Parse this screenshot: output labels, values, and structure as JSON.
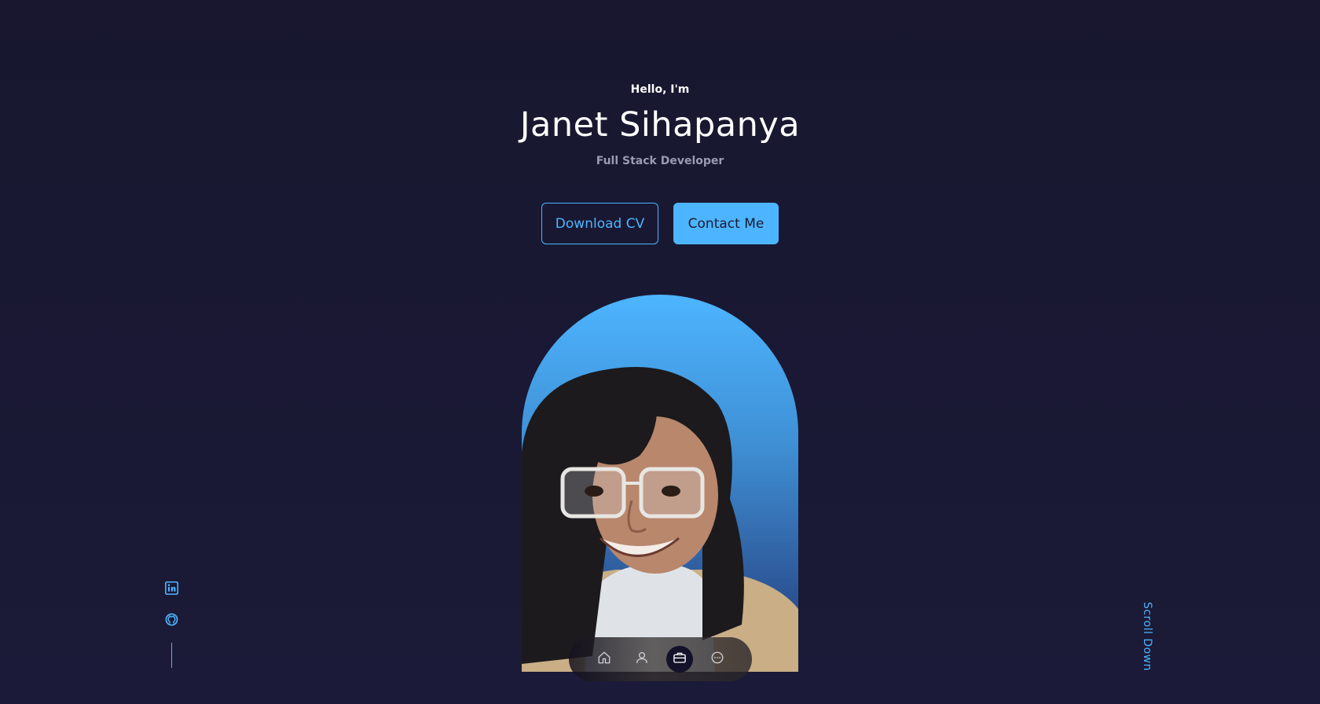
{
  "header": {
    "greeting": "Hello, I'm",
    "name": "Janet Sihapanya",
    "role": "Full Stack Developer"
  },
  "cta": {
    "download_label": "Download CV",
    "contact_label": "Contact Me"
  },
  "social": {
    "links": [
      {
        "icon": "linkedin-icon"
      },
      {
        "icon": "github-icon"
      }
    ]
  },
  "scroll": {
    "label": "Scroll Down"
  },
  "nav": {
    "items": [
      {
        "icon": "home-icon",
        "active": false
      },
      {
        "icon": "user-icon",
        "active": false
      },
      {
        "icon": "briefcase-icon",
        "active": true
      },
      {
        "icon": "chat-icon",
        "active": false
      }
    ]
  },
  "colors": {
    "background": "#1a1a33",
    "accent": "#4db5ff",
    "muted_text": "#9a9ab0"
  }
}
